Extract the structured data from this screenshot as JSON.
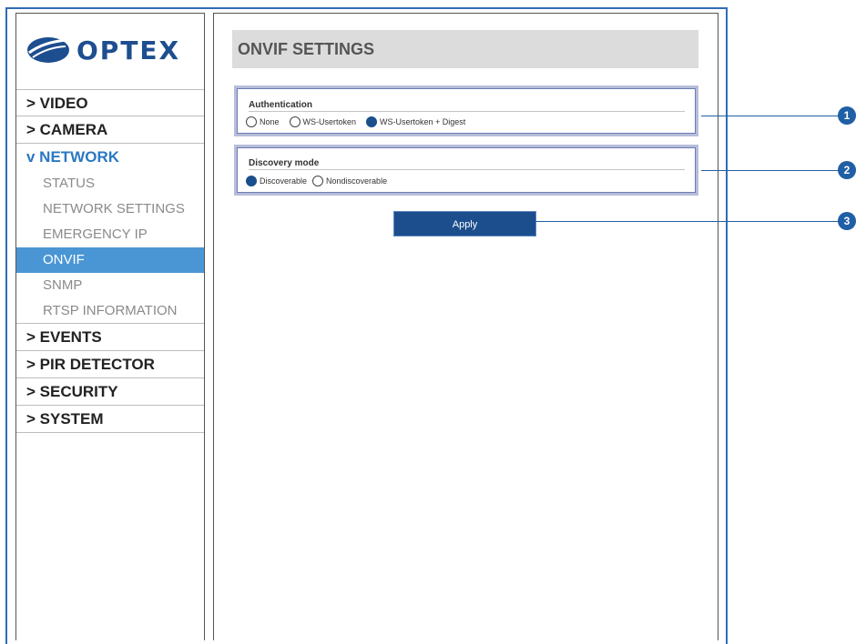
{
  "brand": {
    "logo_text": "OPTEX"
  },
  "sidebar": {
    "items": [
      {
        "label": "> VIDEO"
      },
      {
        "label": "> CAMERA"
      },
      {
        "label": "v NETWORK"
      }
    ],
    "network_sub": [
      {
        "label": "STATUS"
      },
      {
        "label": "NETWORK SETTINGS"
      },
      {
        "label": "EMERGENCY IP"
      },
      {
        "label": "ONVIF"
      },
      {
        "label": "SNMP"
      },
      {
        "label": "RTSP INFORMATION"
      }
    ],
    "items_after": [
      {
        "label": "> EVENTS"
      },
      {
        "label": "> PIR DETECTOR"
      },
      {
        "label": "> SECURITY"
      },
      {
        "label": "> SYSTEM"
      }
    ]
  },
  "main": {
    "title": "ONVIF SETTINGS",
    "authentication": {
      "label": "Authentication",
      "options": [
        "None",
        "WS-Usertoken",
        "WS-Usertoken + Digest"
      ],
      "selected": "WS-Usertoken + Digest"
    },
    "discovery": {
      "label": "Discovery mode",
      "options": [
        "Discoverable",
        "Nondiscoverable"
      ],
      "selected": "Discoverable"
    },
    "apply_label": "Apply"
  },
  "callouts": [
    "1",
    "2",
    "3"
  ],
  "colors": {
    "accent": "#1c4e8e",
    "frame": "#2e6db4",
    "active_nav": "#4a96d4"
  }
}
